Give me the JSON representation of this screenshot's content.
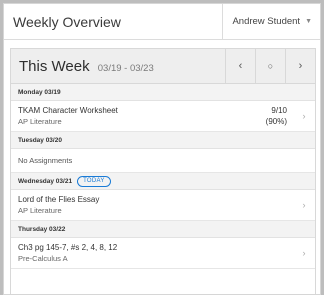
{
  "header": {
    "title": "Weekly Overview",
    "user_name": "Andrew Student",
    "user_caret_icon": "caret-down-icon"
  },
  "week": {
    "title": "This Week",
    "range": "03/19 - 03/23",
    "nav": {
      "prev": "‹",
      "current": "○",
      "next": "›"
    }
  },
  "days": [
    {
      "label": "Monday 03/19",
      "today": false,
      "assignments": [
        {
          "name": "TKAM Character Worksheet",
          "course": "AP Literature",
          "score": "9/10",
          "percent": "(90%)"
        }
      ]
    },
    {
      "label": "Tuesday 03/20",
      "today": false,
      "empty_text": "No Assignments"
    },
    {
      "label": "Wednesday 03/21",
      "today": true,
      "today_label": "TODAY",
      "assignments": [
        {
          "name": "Lord of the Flies Essay",
          "course": "AP Literature"
        }
      ]
    },
    {
      "label": "Thursday 03/22",
      "today": false,
      "assignments": [
        {
          "name": "Ch3 pg 145-7, #s 2, 4, 8, 12",
          "course": "Pre-Calculus A"
        }
      ]
    }
  ],
  "colors": {
    "accent": "#1a7bd6",
    "header_bg": "#eeeeee",
    "day_bg": "#f3f3f3"
  }
}
